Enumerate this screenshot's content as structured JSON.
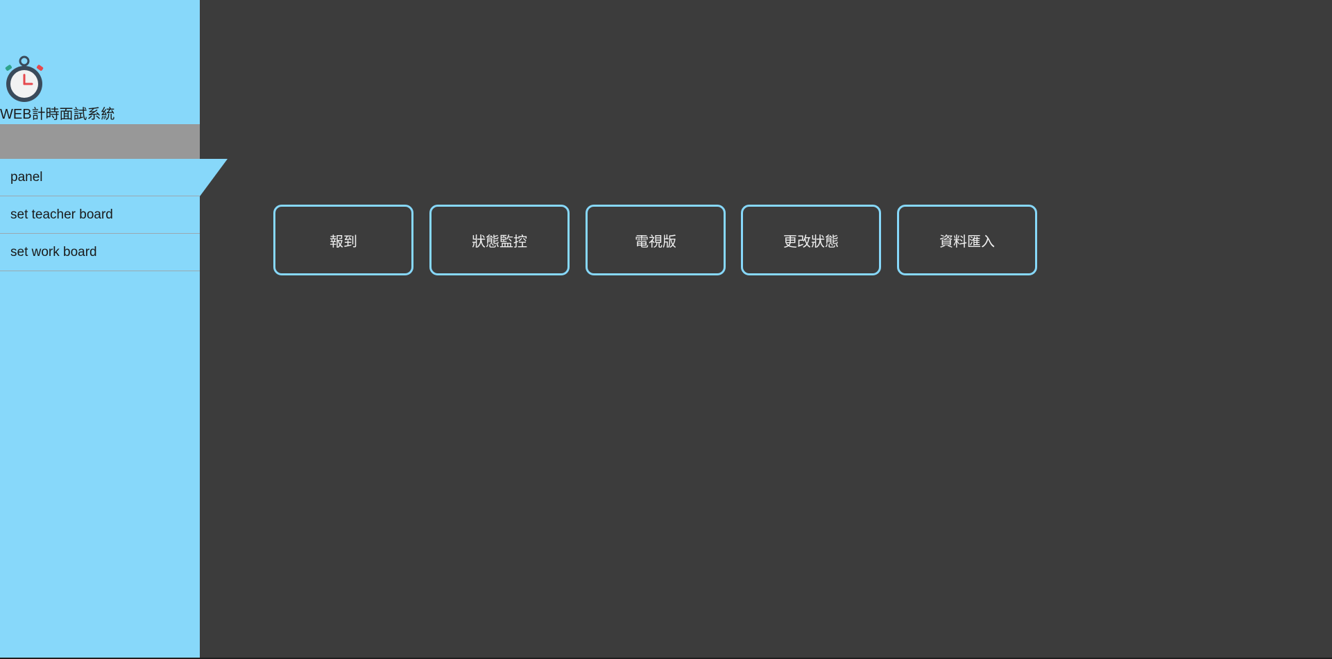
{
  "sidebar": {
    "logo_icon": "stopwatch-icon",
    "app_title": "WEB計時面試系統",
    "items": [
      {
        "label": "panel"
      },
      {
        "label": "set teacher board"
      },
      {
        "label": "set work board"
      }
    ]
  },
  "main": {
    "buttons": [
      {
        "label": "報到"
      },
      {
        "label": "狀態監控"
      },
      {
        "label": "電視版"
      },
      {
        "label": "更改狀態"
      },
      {
        "label": "資料匯入"
      }
    ]
  },
  "colors": {
    "sidebar_bg": "#87d8fa",
    "main_bg": "#3c3c3c",
    "band_gray": "#989898",
    "button_border": "#87d8fa",
    "button_text": "#f0f0f0"
  }
}
